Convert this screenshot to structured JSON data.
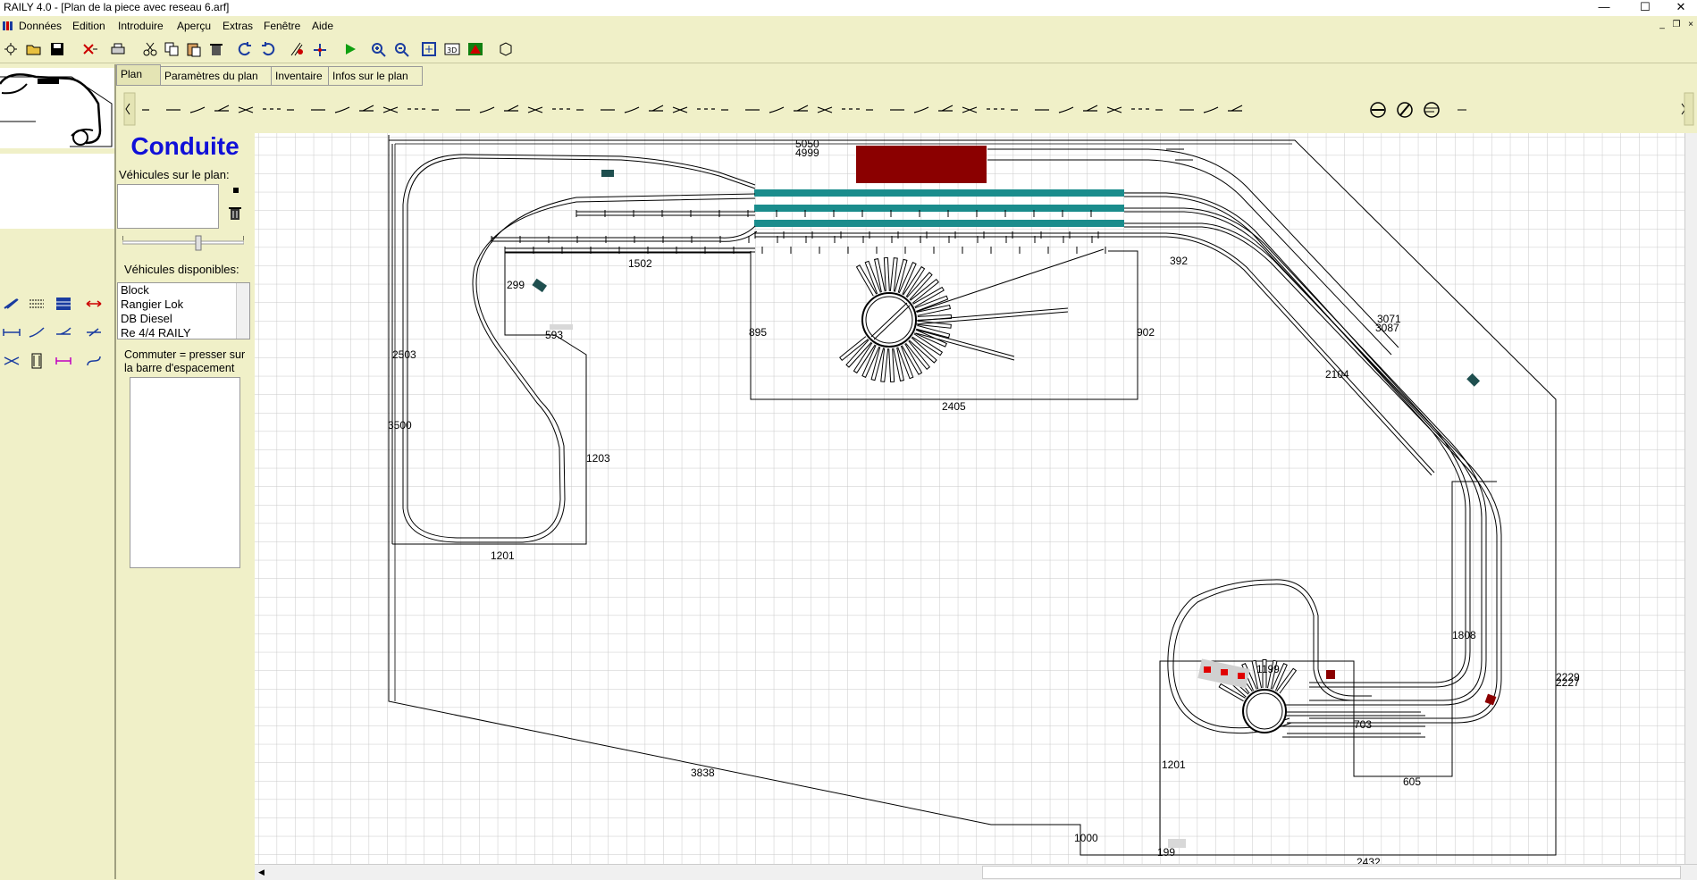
{
  "window": {
    "title": "RAILY 4.0 - [Plan de la piece avec reseau 6.arf]",
    "controls": [
      "—",
      "☐",
      "✕"
    ],
    "mdi_controls": [
      "_",
      "❐",
      "×"
    ]
  },
  "menu": {
    "items": [
      "Données",
      "Edition",
      "Introduire",
      "Aperçu",
      "Extras",
      "Fenêtre",
      "Aide"
    ]
  },
  "tabs": [
    "Plan",
    "Paramètres du plan",
    "Inventaire",
    "Infos sur le plan"
  ],
  "conduite": {
    "title": "Conduite",
    "vehicles_on_plan_label": "Véhicules sur le plan:",
    "available_label": "Véhicules disponibles:",
    "available": [
      "Block",
      "Rangier Lok",
      "DB Diesel",
      "Re 4/4 RAILY"
    ],
    "hint": "Commuter = presser sur la barre d'espacement"
  },
  "dimensions": {
    "d5050": "5050",
    "d4999": "4999",
    "d1502": "1502",
    "d392": "392",
    "d299": "299",
    "d593": "593",
    "d2503": "2503",
    "d895": "895",
    "d902": "902",
    "d2405": "2405",
    "d3500": "3500",
    "d1203": "1203",
    "d1201a": "1201",
    "d3071": "3071",
    "d3087": "3087",
    "d2104": "2104",
    "d1808": "1808",
    "d2229": "2229",
    "d2227": "2227",
    "d1199": "1199",
    "d703": "703",
    "d1201b": "1201",
    "d605": "605",
    "d3838": "3838",
    "d1000": "1000",
    "d199": "199",
    "d2432": "2432"
  },
  "colors": {
    "background": "#f0f0c8",
    "accent_title": "#1010d8",
    "station_block": "#8b0000",
    "platform_teal": "#1a8c8c",
    "vehicle_dark": "#1f4f4f",
    "vehicle_red": "#e00000"
  }
}
